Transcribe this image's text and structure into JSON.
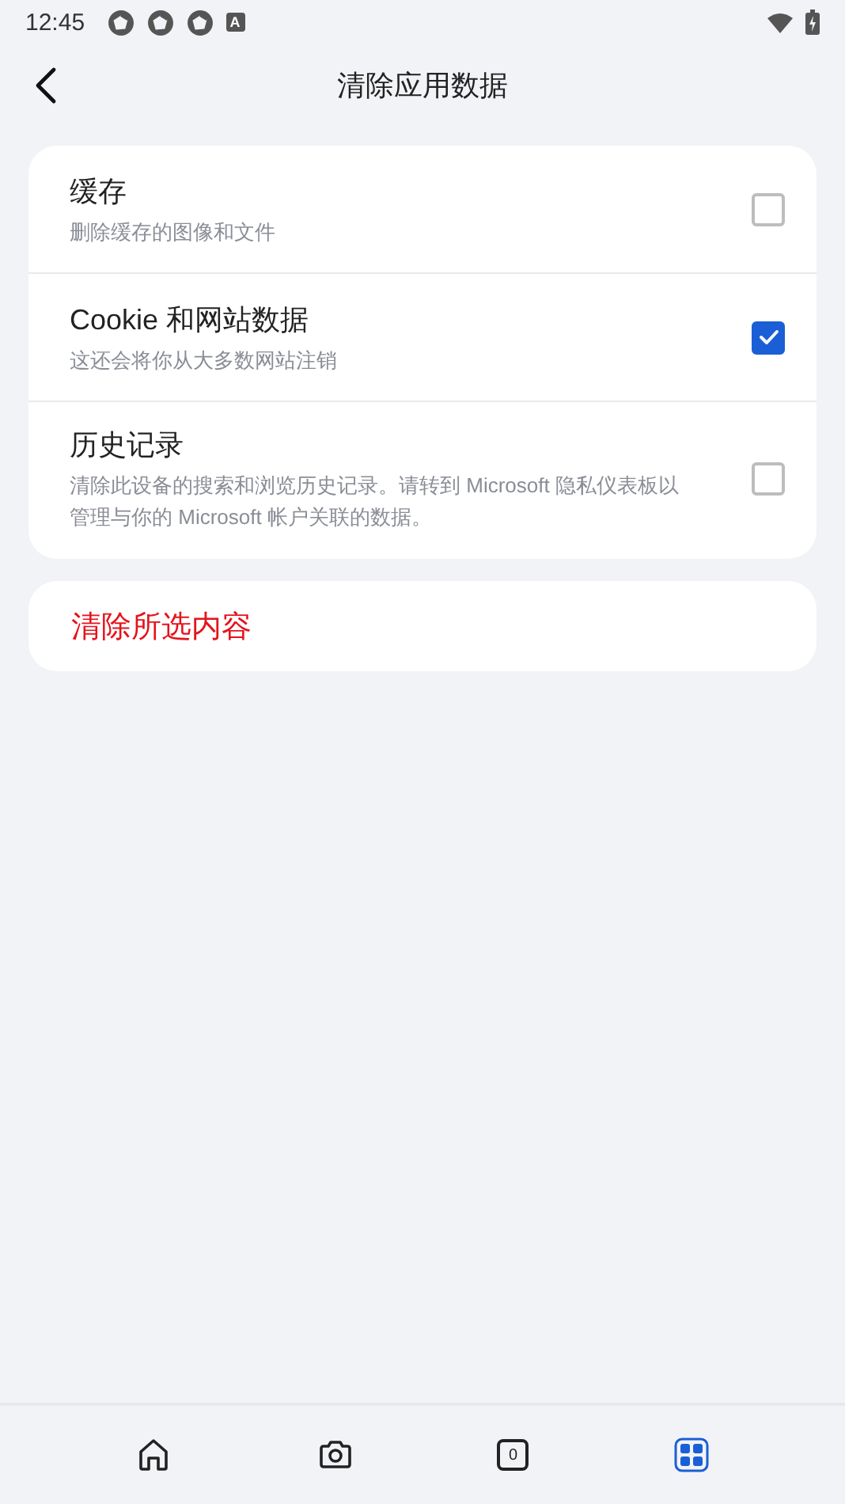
{
  "status_bar": {
    "time": "12:45",
    "badge": "A"
  },
  "header": {
    "title": "清除应用数据"
  },
  "options": [
    {
      "title": "缓存",
      "description": "删除缓存的图像和文件",
      "checked": false
    },
    {
      "title": "Cookie 和网站数据",
      "description": "这还会将你从大多数网站注销",
      "checked": true
    },
    {
      "title": "历史记录",
      "description": "清除此设备的搜索和浏览历史记录。请转到 Microsoft 隐私仪表板以管理与你的 Microsoft 帐户关联的数据。",
      "checked": false
    }
  ],
  "clear_button": {
    "label": "清除所选内容"
  },
  "bottom_nav": {
    "tab_count": "0"
  }
}
